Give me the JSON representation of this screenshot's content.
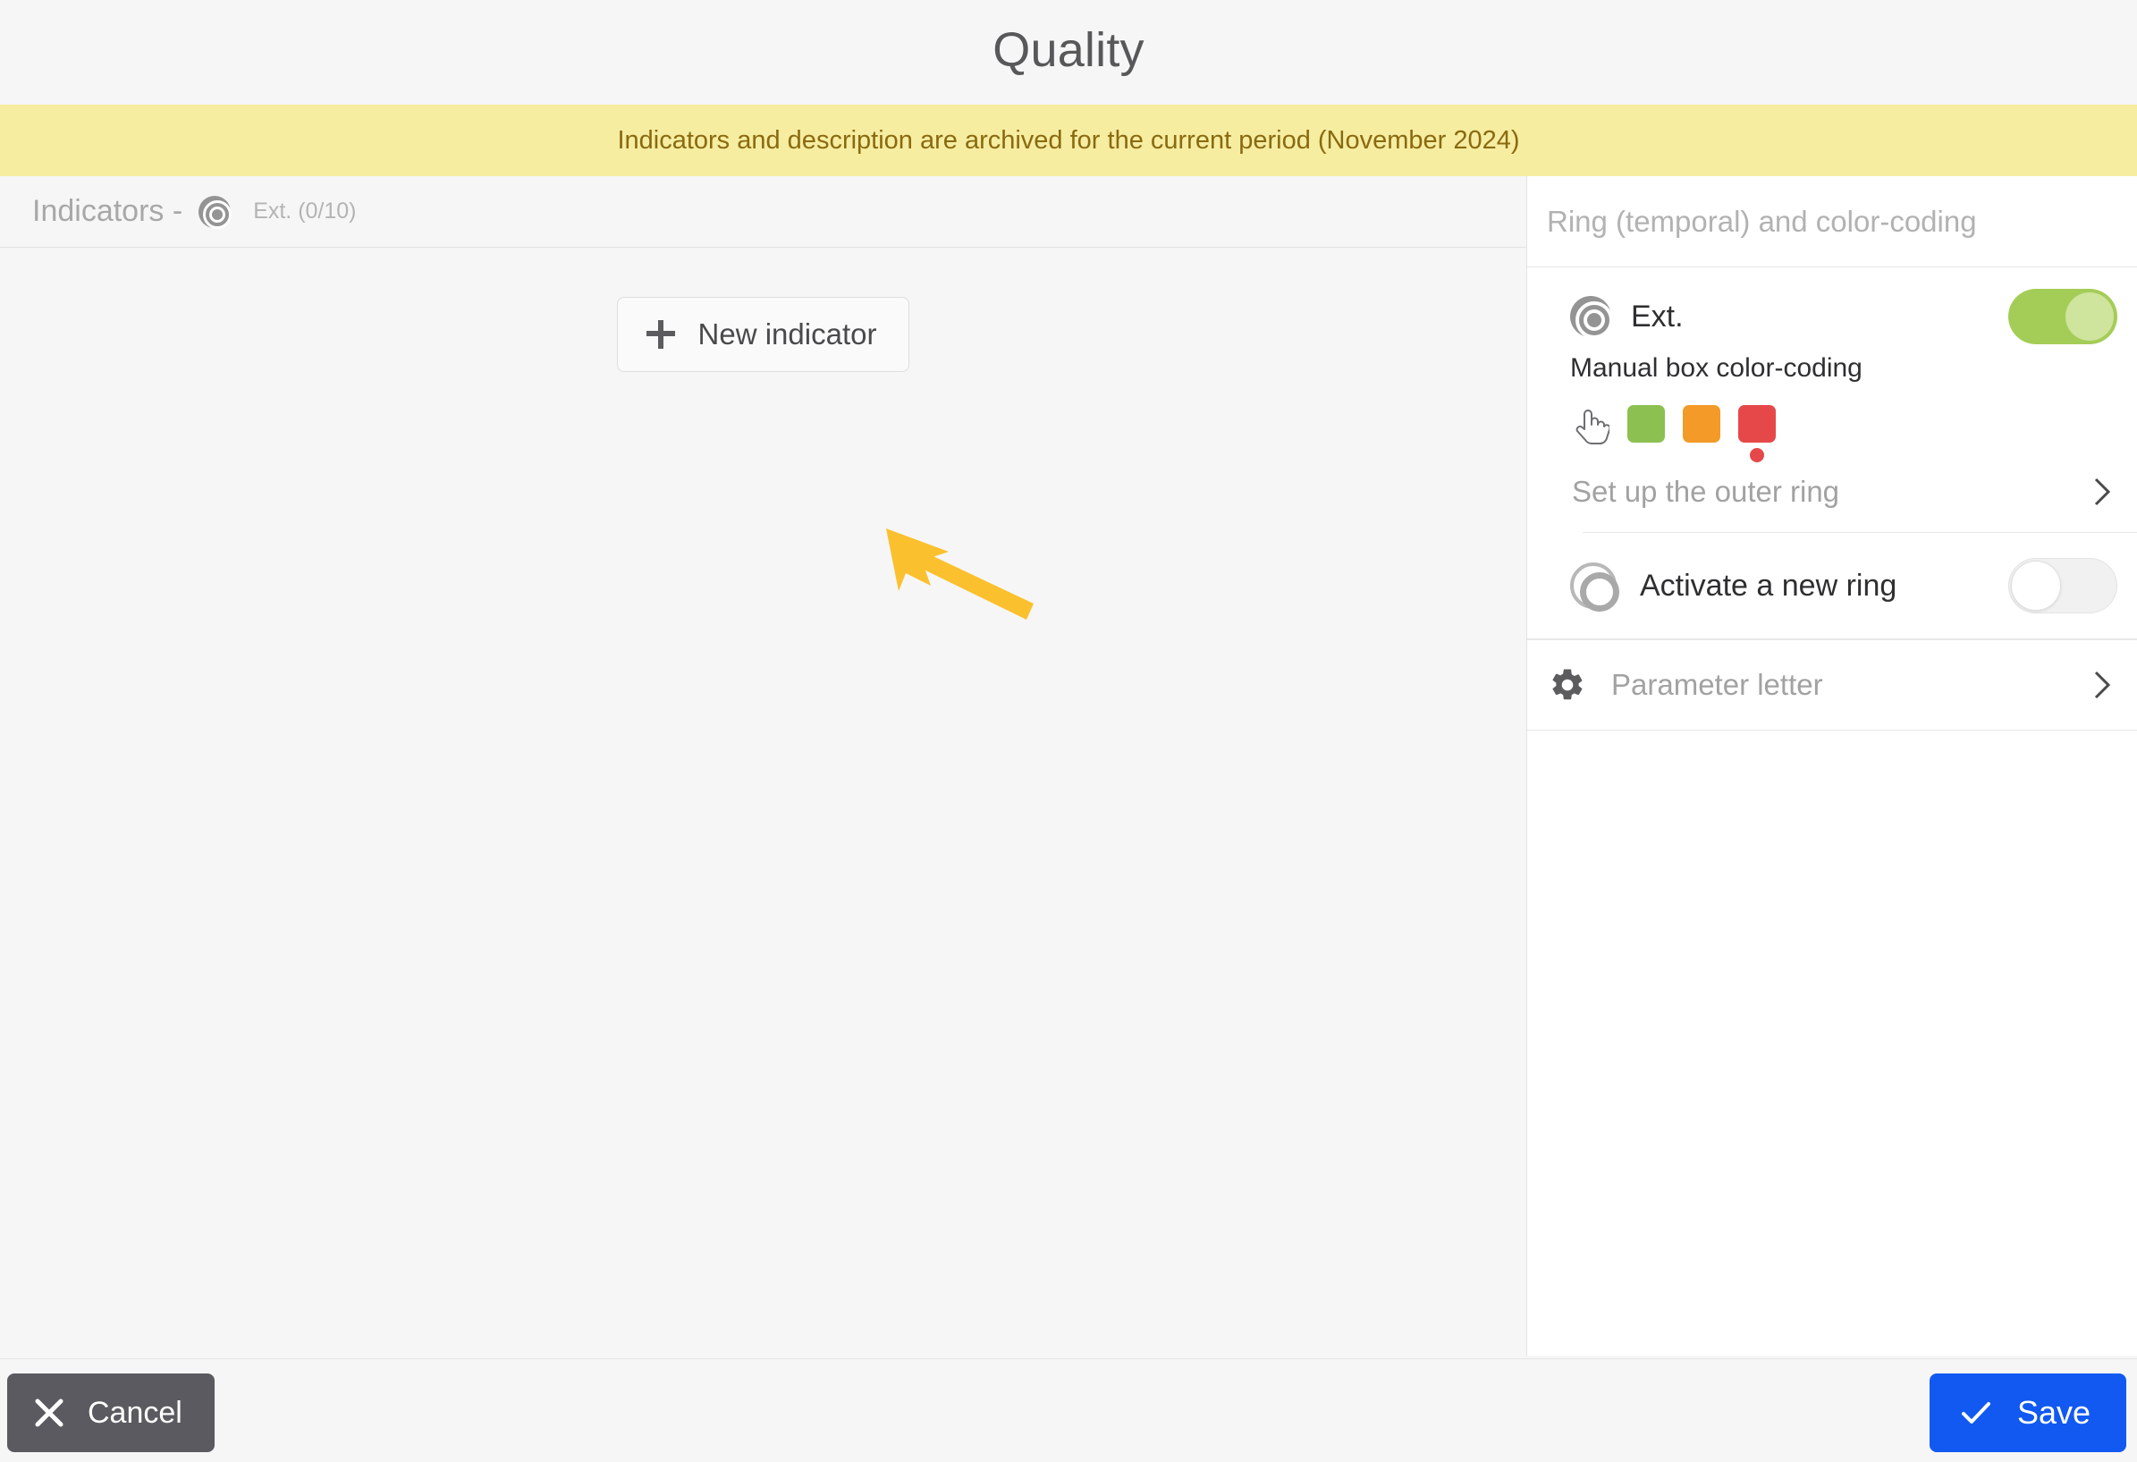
{
  "window": {
    "title": "Quality"
  },
  "banner": {
    "message": "Indicators and description are archived for the current period (November 2024)",
    "background_color": "#f6eda1",
    "text_color": "#8a6a10"
  },
  "main": {
    "indicators_header": {
      "label": "Indicators -",
      "ring_icon": "target-ring-icon",
      "count": "Ext. (0/10)"
    },
    "new_indicator_button": {
      "icon": "plus-icon",
      "label": "New indicator"
    },
    "annotation": {
      "type": "arrow",
      "color": "#fbc02d",
      "points_to": "new-indicator-button"
    }
  },
  "sidebar": {
    "title": "Ring (temporal) and color-coding",
    "ring": {
      "icon": "target-ring-icon",
      "name": "Ext.",
      "toggle_state": "on",
      "toggle_on_color": "#a4cd57",
      "manual_label": "Manual box color-coding",
      "swatches": [
        {
          "name": "hand-pointer-icon",
          "color": "none",
          "selected": false
        },
        {
          "name": "green-swatch",
          "color": "#8cc152",
          "selected": false
        },
        {
          "name": "orange-swatch",
          "color": "#f39a28",
          "selected": false
        },
        {
          "name": "red-swatch",
          "color": "#e6484a",
          "selected": true
        }
      ],
      "outer_ring_label": "Set up the outer ring",
      "chevron": "chevron-right-icon"
    },
    "activate_ring": {
      "icon": "ring-outline-icon",
      "label": "Activate a new ring",
      "toggle_state": "off"
    },
    "parameter": {
      "icon": "gear-icon",
      "label": "Parameter letter",
      "chevron": "chevron-right-icon"
    }
  },
  "footer": {
    "cancel": {
      "icon": "close-x-icon",
      "label": "Cancel",
      "color": "#5a5a60"
    },
    "save": {
      "icon": "checkmark-icon",
      "label": "Save",
      "color": "#1259f2"
    }
  }
}
